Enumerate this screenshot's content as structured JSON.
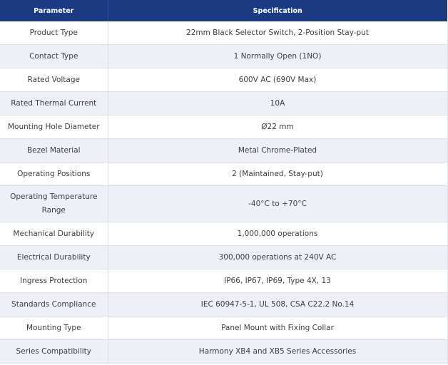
{
  "table": {
    "headers": [
      "Parameter",
      "Specification"
    ],
    "rows": [
      {
        "parameter": "Product Type",
        "specification": "22mm Black Selector Switch, 2-Position Stay-put"
      },
      {
        "parameter": "Contact Type",
        "specification": "1 Normally Open (1NO)"
      },
      {
        "parameter": "Rated Voltage",
        "specification": "600V AC (690V Max)"
      },
      {
        "parameter": "Rated Thermal Current",
        "specification": "10A"
      },
      {
        "parameter": "Mounting Hole Diameter",
        "specification": "Ø22 mm"
      },
      {
        "parameter": "Bezel Material",
        "specification": "Metal Chrome-Plated"
      },
      {
        "parameter": "Operating Positions",
        "specification": "2 (Maintained, Stay-put)"
      },
      {
        "parameter": "Operating Temperature Range",
        "specification": "-40°C to +70°C"
      },
      {
        "parameter": "Mechanical Durability",
        "specification": "1,000,000 operations"
      },
      {
        "parameter": "Electrical Durability",
        "specification": "300,000 operations at 240V AC"
      },
      {
        "parameter": "Ingress Protection",
        "specification": "IP66, IP67, IP69, Type 4X, 13"
      },
      {
        "parameter": "Standards Compliance",
        "specification": "IEC 60947-5-1, UL 508, CSA C22.2 No.14"
      },
      {
        "parameter": "Mounting Type",
        "specification": "Panel Mount with Fixing Collar"
      },
      {
        "parameter": "Series Compatibility",
        "specification": "Harmony XB4 and XB5 Series Accessories"
      }
    ]
  },
  "colors": {
    "header_bg": "#1b3a82",
    "header_text": "#ffffff",
    "alt_row_bg": "#eef0f7",
    "border": "#dcdfe6"
  }
}
